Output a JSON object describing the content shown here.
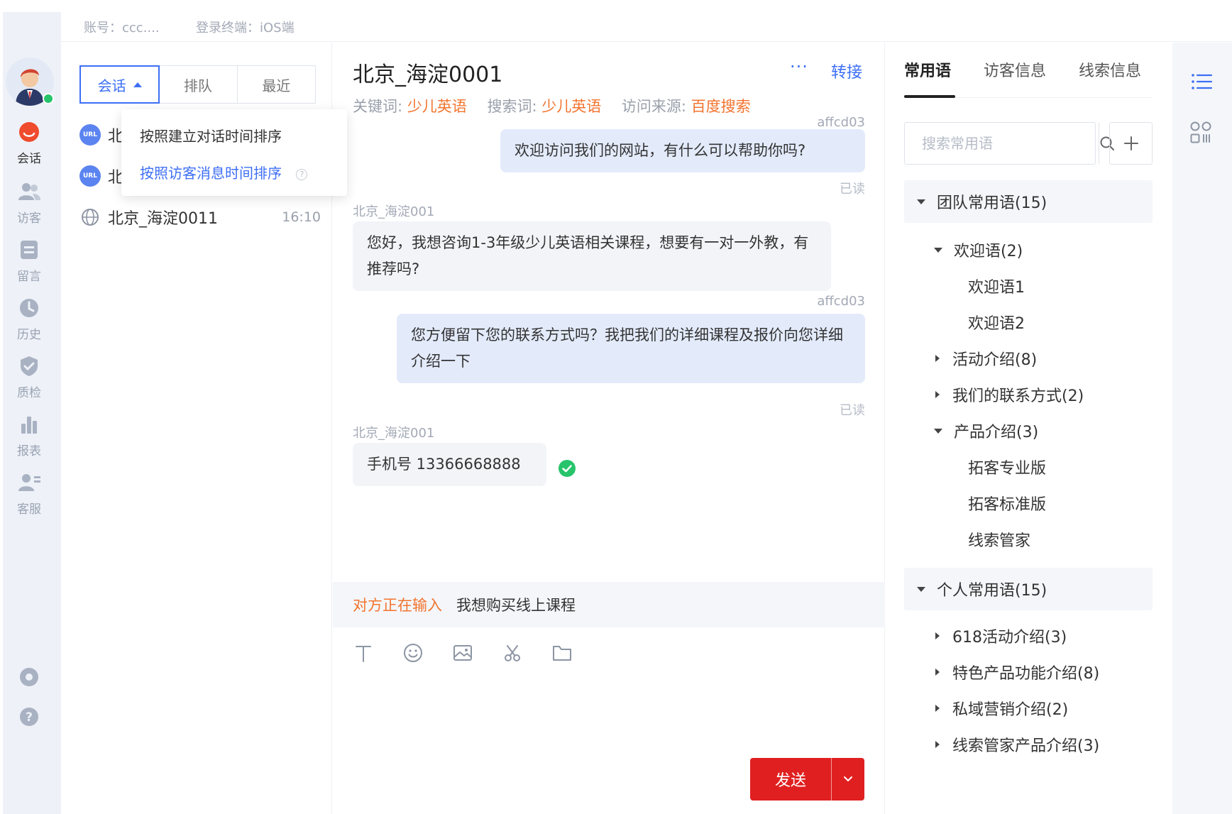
{
  "topbar": {
    "account": "账号：ccc....",
    "terminal": "登录终端：iOS端"
  },
  "nav": {
    "items": [
      {
        "label": "会话",
        "icon": "chat-icon",
        "active": true
      },
      {
        "label": "访客",
        "icon": "visitors-icon"
      },
      {
        "label": "留言",
        "icon": "message-icon"
      },
      {
        "label": "历史",
        "icon": "history-icon"
      },
      {
        "label": "质检",
        "icon": "quality-shield-icon"
      },
      {
        "label": "报表",
        "icon": "report-chart-icon"
      },
      {
        "label": "客服",
        "icon": "agent-icon"
      }
    ],
    "bottom_icons": [
      "settings-icon",
      "help-icon"
    ]
  },
  "sessions": {
    "tabs": [
      "会话",
      "排队",
      "最近"
    ],
    "sort_menu": [
      "按照建立对话时间排序",
      "按照访客消息时间排序"
    ],
    "rows": [
      {
        "badge": "URL",
        "name": "北"
      },
      {
        "badge": "URL",
        "name": "北"
      },
      {
        "name": "北京_海淀0011",
        "time": "16:10"
      }
    ]
  },
  "chat": {
    "title": "北京_海淀0001",
    "more": "···",
    "transfer": "转接",
    "keyword_label": "关键词:",
    "keyword": "少儿英语",
    "search_label": "搜索词:",
    "search_term": "少儿英语",
    "source_label": "访问来源:",
    "source": "百度搜索",
    "messages": [
      {
        "sender": "affcd03",
        "text": "欢迎访问我们的网站，有什么可以帮助你吗?",
        "status": "已读"
      },
      {
        "sender": "北京_海淀001",
        "text": "您好，我想咨询1-3年级少儿英语相关课程，想要有一对一外教，有推荐吗?"
      },
      {
        "sender": "affcd03",
        "text": "您方便留下您的联系方式吗？我把我们的详细课程及报价向您详细介绍一下",
        "status": "已读"
      },
      {
        "sender": "北京_海淀001",
        "text": "手机号 13366668888"
      }
    ],
    "typing_indicator": "对方正在输入",
    "typing_text": "我想购买线上课程",
    "send_label": "发送"
  },
  "phrases": {
    "tabs": [
      "常用语",
      "访客信息",
      "线索信息"
    ],
    "search_placeholder": "搜索常用语",
    "team_group": "团队常用语(15)",
    "team_items": [
      {
        "label": "欢迎语(2)",
        "expanded": true,
        "children": [
          "欢迎语1",
          "欢迎语2"
        ]
      },
      {
        "label": "活动介绍(8)"
      },
      {
        "label": "我们的联系方式(2)"
      },
      {
        "label": "产品介绍(3)",
        "expanded": true,
        "children": [
          "拓客专业版",
          "拓客标准版",
          "线索管家"
        ]
      }
    ],
    "personal_group": "个人常用语(15)",
    "personal_items": [
      {
        "label": "618活动介绍(3)"
      },
      {
        "label": "特色产品功能介绍(8)"
      },
      {
        "label": "私域营销介绍(2)"
      },
      {
        "label": "线索管家产品介绍(3)"
      }
    ]
  },
  "colors": {
    "accent": "#3d6ff5",
    "highlight": "#f2742f",
    "send": "#e02020",
    "online": "#27c46b"
  }
}
